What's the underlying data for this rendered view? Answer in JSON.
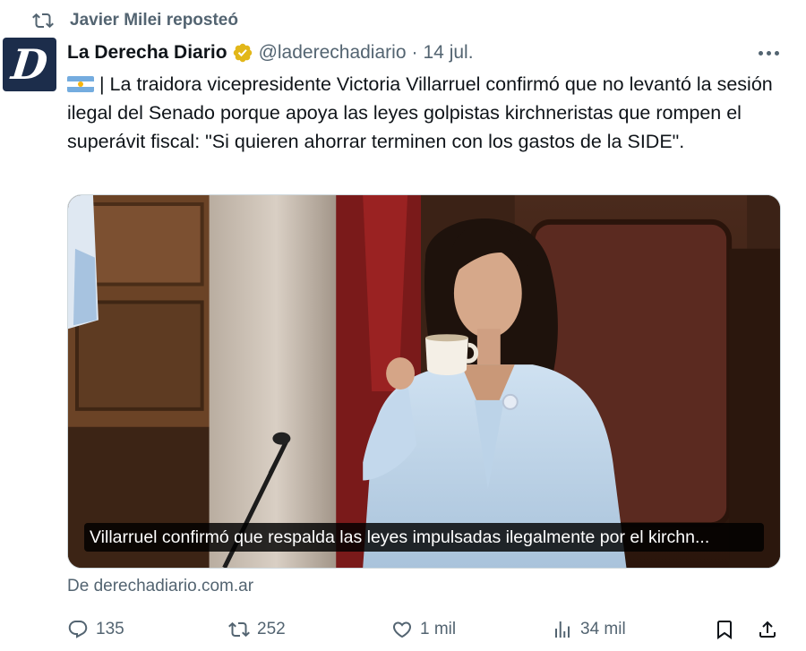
{
  "social_context": {
    "text": "Javier Milei reposteó",
    "icon": "repost-icon"
  },
  "author": {
    "avatar_letter": "D",
    "name": "La Derecha Diario",
    "verified": true,
    "handle": "@laderechadiario",
    "separator": "·",
    "date": "14 jul."
  },
  "tweet": {
    "flag": "argentina-flag",
    "text": "| La traidora vicepresidente Victoria Villarruel confirmó que no levantó la sesión ilegal del Senado porque apoya las leyes golpistas kirchneristas que rompen el superávit fiscal: \"Si quieren ahorrar terminen con los gastos de la SIDE\"."
  },
  "media": {
    "caption": "Villarruel confirmó que respalda las leyes impulsadas ilegalmente por el kirchn..."
  },
  "source_link": "De derechadiario.com.ar",
  "actions": {
    "replies": "135",
    "reposts": "252",
    "likes": "1 mil",
    "views": "34 mil"
  },
  "colors": {
    "text_primary": "#0f1419",
    "text_secondary": "#536471",
    "verified_gold": "#e2b719",
    "avatar_bg": "#1c2d4b"
  }
}
